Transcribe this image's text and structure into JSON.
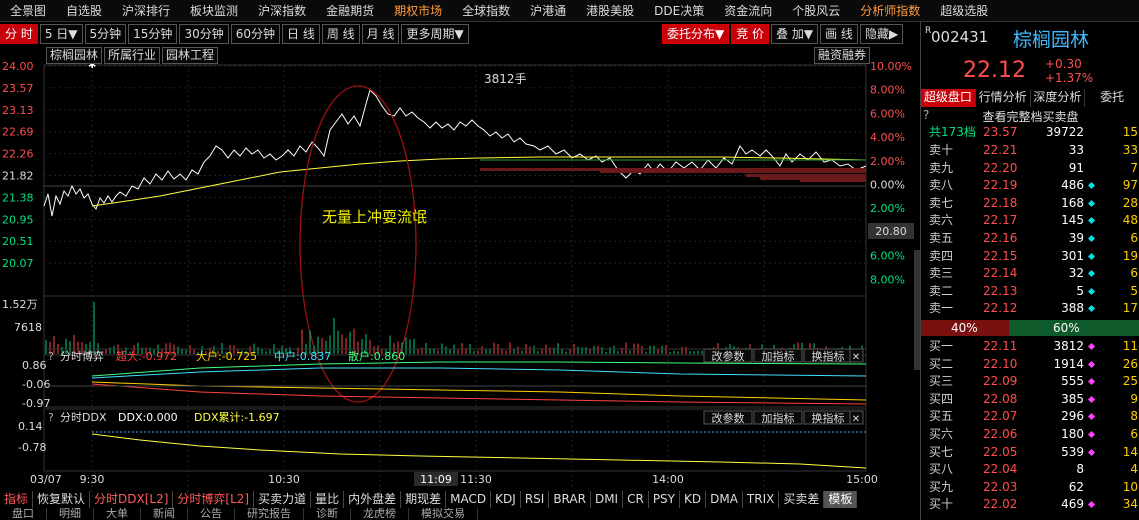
{
  "topmenu": [
    "全景图",
    "自选股",
    "沪深排行",
    "板块监测",
    "沪深指数",
    "金融期货",
    "期权市场",
    "全球指数",
    "沪港通",
    "港股美股",
    "DDE决策",
    "资金流向",
    "个股风云",
    "分析师指数",
    "超级选股"
  ],
  "topmenu_active": [
    6,
    13
  ],
  "periods": [
    "分 时",
    "5 日▼",
    "5分钟",
    "15分钟",
    "30分钟",
    "60分钟",
    "日 线",
    "周 线",
    "月 线",
    "更多周期▼"
  ],
  "right_buttons": [
    "委托分布▼",
    "竞 价",
    "叠 加▼",
    "画 线",
    "隐藏▶"
  ],
  "stock_tabs": [
    "棕榈园林",
    "所属行业",
    "园林工程"
  ],
  "rongzi": "融资融券",
  "price_axis": [
    "24.00",
    "23.57",
    "23.13",
    "22.69",
    "22.26",
    "21.82",
    "21.38",
    "20.95",
    "20.51",
    "20.07"
  ],
  "pct_axis": [
    "10.00%",
    "8.00%",
    "6.00%",
    "4.00%",
    "2.00%",
    "0.00%",
    "2.00%",
    "4.00%",
    "6.00%",
    "8.00%"
  ],
  "vol_axis": [
    "1.52万",
    "7618"
  ],
  "annotation": "无量上冲耍流氓",
  "volume_marker": "3812手",
  "price_tag": "20.80",
  "boyi": {
    "title": "分时博弈",
    "chao": "超大:-0.972",
    "da": "大户:-0.725",
    "zhong": "中户:0.837",
    "san": "散户:0.860",
    "axis": [
      "0.86",
      "-0.06",
      "-0.97"
    ]
  },
  "ddx": {
    "title": "分时DDX",
    "ddx": "DDX:0.000",
    "ddxsum": "DDX累计:-1.697",
    "axis": [
      "0.14",
      "-0.78"
    ]
  },
  "panel_buttons": [
    "改参数",
    "加指标",
    "换指标"
  ],
  "time_axis": [
    "03/07",
    "9:30",
    "10:30",
    "11:09",
    "11:30",
    "14:00",
    "15:00"
  ],
  "bottom_tabs": [
    "指标",
    "恢复默认",
    "分时DDX[L2]",
    "分时博弈[L2]",
    "买卖力道",
    "量比",
    "内外盘差",
    "期现差",
    "MACD",
    "KDJ",
    "RSI",
    "BRAR",
    "DMI",
    "CR",
    "PSY",
    "KD",
    "DMA",
    "TRIX",
    "买卖差",
    "模板"
  ],
  "bottom2": [
    "盘口",
    "明细",
    "大单",
    "新闻",
    "公告",
    "研究报告",
    "诊断",
    "龙虎榜",
    "模拟交易"
  ],
  "stock": {
    "prefix": "R",
    "code": "002431",
    "name": "棕榈园林",
    "price": "22.12",
    "change": "+0.30",
    "pct": "+1.37%"
  },
  "order_tabs": [
    "超级盘口",
    "行情分析",
    "深度分析",
    "委托"
  ],
  "order_link": "查看完整档买卖盘",
  "order_summary": {
    "label": "共173档",
    "price": "23.57",
    "vol": "39722",
    "cnt": "15"
  },
  "asks": [
    {
      "label": "卖十",
      "price": "22.21",
      "vol": "33",
      "cnt": "33",
      "dot": ""
    },
    {
      "label": "卖九",
      "price": "22.20",
      "vol": "91",
      "cnt": "7",
      "dot": ""
    },
    {
      "label": "卖八",
      "price": "22.19",
      "vol": "486",
      "cnt": "97",
      "dot": "#00e0e0"
    },
    {
      "label": "卖七",
      "price": "22.18",
      "vol": "168",
      "cnt": "28",
      "dot": "#00e0e0"
    },
    {
      "label": "卖六",
      "price": "22.17",
      "vol": "145",
      "cnt": "48",
      "dot": "#00e0e0"
    },
    {
      "label": "卖五",
      "price": "22.16",
      "vol": "39",
      "cnt": "6",
      "dot": "#00e0e0"
    },
    {
      "label": "卖四",
      "price": "22.15",
      "vol": "301",
      "cnt": "19",
      "dot": "#00e0e0"
    },
    {
      "label": "卖三",
      "price": "22.14",
      "vol": "32",
      "cnt": "6",
      "dot": "#00e0e0"
    },
    {
      "label": "卖二",
      "price": "22.13",
      "vol": "5",
      "cnt": "5",
      "dot": "#00e0e0"
    },
    {
      "label": "卖一",
      "price": "22.12",
      "vol": "388",
      "cnt": "17",
      "dot": "#00e0e0"
    }
  ],
  "ratio": {
    "left": "40%",
    "right": "60%",
    "left_frac": 0.4
  },
  "bids": [
    {
      "label": "买一",
      "price": "22.11",
      "vol": "3812",
      "cnt": "11",
      "dot": "#ff40ff"
    },
    {
      "label": "买二",
      "price": "22.10",
      "vol": "1914",
      "cnt": "26",
      "dot": "#ff40ff"
    },
    {
      "label": "买三",
      "price": "22.09",
      "vso": "",
      "vol": "555",
      "cnt": "25",
      "dot": "#ff40ff"
    },
    {
      "label": "买四",
      "price": "22.08",
      "vol": "385",
      "cnt": "9",
      "dot": "#ff40ff"
    },
    {
      "label": "买五",
      "price": "22.07",
      "vol": "296",
      "cnt": "8",
      "dot": "#ff40ff"
    },
    {
      "label": "买六",
      "price": "22.06",
      "vol": "180",
      "cnt": "6",
      "dot": "#ff40ff"
    },
    {
      "label": "买七",
      "price": "22.05",
      "vol": "539",
      "cnt": "14",
      "dot": "#ff40ff"
    },
    {
      "label": "买八",
      "price": "22.04",
      "vol": "8",
      "cnt": "4",
      "dot": ""
    },
    {
      "label": "买九",
      "price": "22.03",
      "vol": "62",
      "cnt": "10",
      "dot": ""
    },
    {
      "label": "买十",
      "price": "22.02",
      "vol": "469",
      "cnt": "34",
      "dot": "#ff40ff"
    }
  ],
  "colors": {
    "up": "#ff4d4d",
    "down": "#00e080",
    "price_line": "#ffffff",
    "avg_line": "#ffff40",
    "accent": "#c8000a"
  }
}
